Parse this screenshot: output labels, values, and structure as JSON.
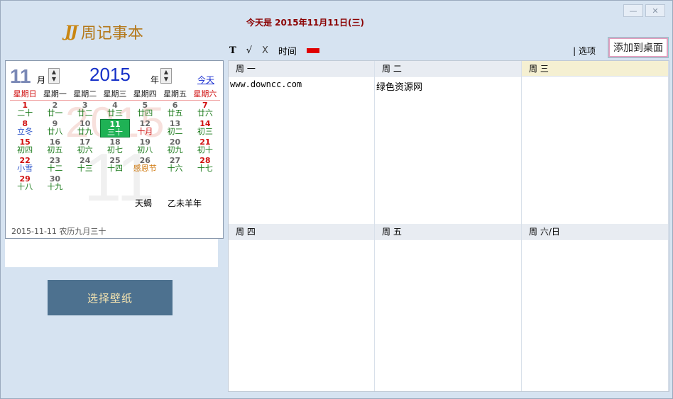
{
  "window": {
    "minimize_icon": "minimize-icon",
    "close_icon": "close-icon"
  },
  "logo": {
    "mark": "JJ",
    "text": "周记事本"
  },
  "header": {
    "today_text": "今天是 2015年11月11日(三)"
  },
  "calendar": {
    "month": "11",
    "month_label": "月",
    "year": "2015",
    "year_label": "年",
    "today_link": "今天",
    "weekdays": [
      "星期日",
      "星期一",
      "星期二",
      "星期三",
      "星期四",
      "星期五",
      "星期六"
    ],
    "bg_year": "2015",
    "bg_month": "11",
    "days": [
      {
        "n": "1",
        "l": "二十"
      },
      {
        "n": "2",
        "l": "廿一"
      },
      {
        "n": "3",
        "l": "廿二"
      },
      {
        "n": "4",
        "l": "廿三"
      },
      {
        "n": "5",
        "l": "廿四"
      },
      {
        "n": "6",
        "l": "廿五"
      },
      {
        "n": "7",
        "l": "廿六"
      },
      {
        "n": "8",
        "l": "立冬"
      },
      {
        "n": "9",
        "l": "廿八"
      },
      {
        "n": "10",
        "l": "廿九"
      },
      {
        "n": "11",
        "l": "三十"
      },
      {
        "n": "12",
        "l": "十月"
      },
      {
        "n": "13",
        "l": "初二"
      },
      {
        "n": "14",
        "l": "初三"
      },
      {
        "n": "15",
        "l": "初四"
      },
      {
        "n": "16",
        "l": "初五"
      },
      {
        "n": "17",
        "l": "初六"
      },
      {
        "n": "18",
        "l": "初七"
      },
      {
        "n": "19",
        "l": "初八"
      },
      {
        "n": "20",
        "l": "初九"
      },
      {
        "n": "21",
        "l": "初十"
      },
      {
        "n": "22",
        "l": "小雪"
      },
      {
        "n": "23",
        "l": "十二"
      },
      {
        "n": "24",
        "l": "十三"
      },
      {
        "n": "25",
        "l": "十四"
      },
      {
        "n": "26",
        "l": "感恩节"
      },
      {
        "n": "27",
        "l": "十六"
      },
      {
        "n": "28",
        "l": "十七"
      },
      {
        "n": "29",
        "l": "十八"
      },
      {
        "n": "30",
        "l": "十九"
      }
    ],
    "extra_1": "天蝎",
    "extra_2": "乙未羊年",
    "footer": "2015-11-11 农历九月三十"
  },
  "wallpaper_button": "选择壁纸",
  "toolbar": {
    "bold": "T",
    "check": "√",
    "cross": "X",
    "time": "时间",
    "options": "| 选项",
    "add_desktop": "添加到桌面"
  },
  "week": {
    "cols": [
      {
        "head": "周 一",
        "body": "www.downcc.com"
      },
      {
        "head": "周 二",
        "body": "绿色资源网"
      },
      {
        "head": "周 三",
        "body": ""
      },
      {
        "head": "周 四",
        "body": ""
      },
      {
        "head": "周 五",
        "body": ""
      },
      {
        "head": "周 六/日",
        "body": ""
      }
    ]
  },
  "colors": {
    "accent_red": "#e00000",
    "selected_day": "#1fb255",
    "wallpaper_btn": "#4d718f"
  }
}
